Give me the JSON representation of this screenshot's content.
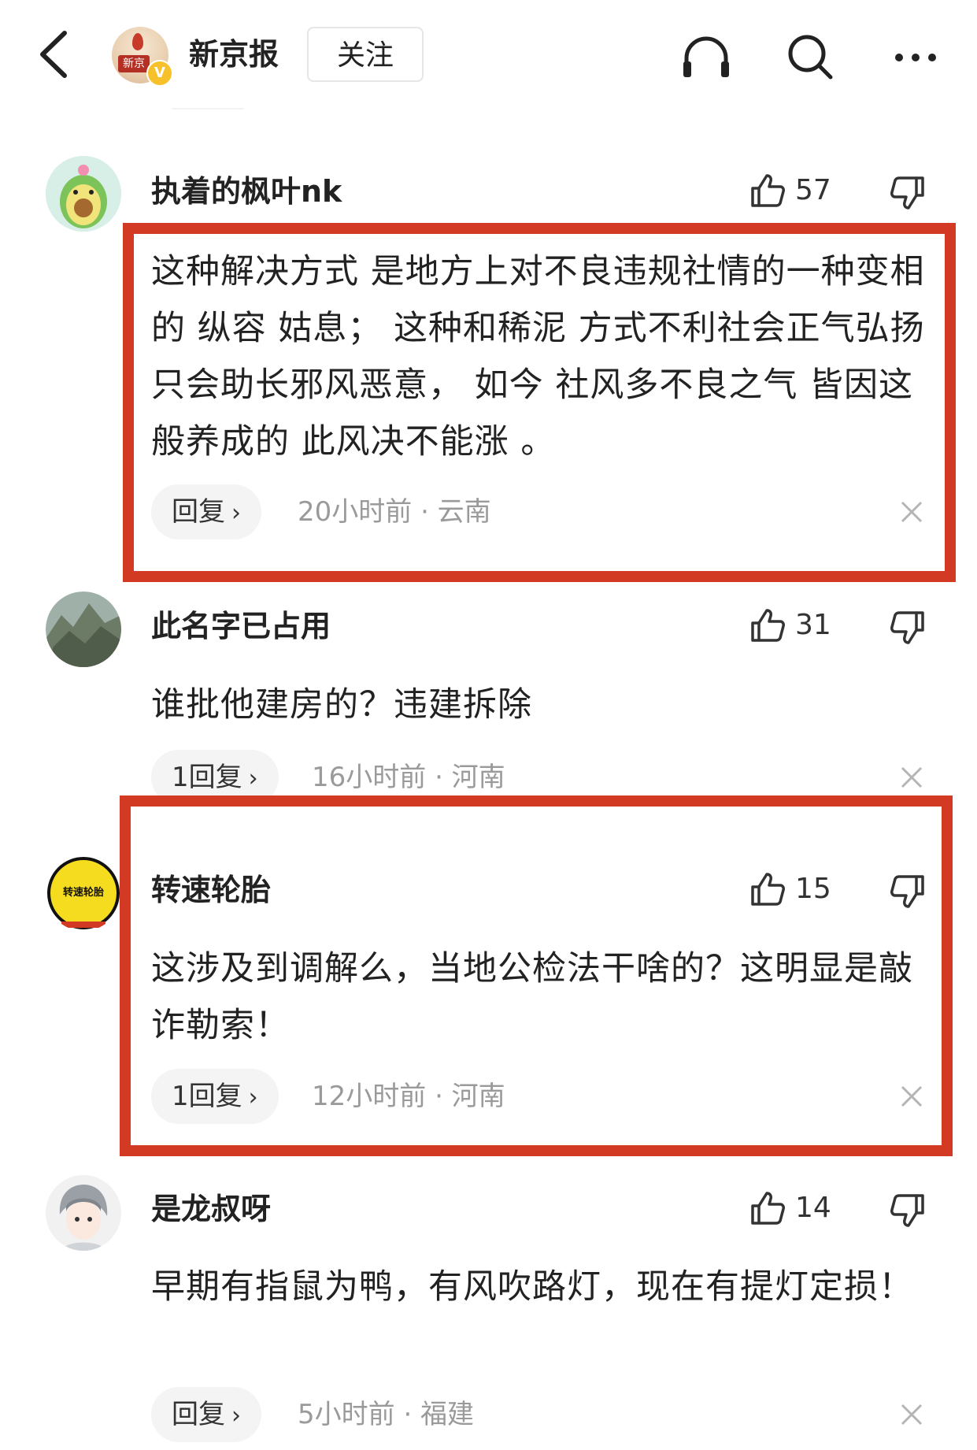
{
  "header": {
    "channel_name": "新京报",
    "avatar_text": "新京",
    "vip_badge": "V",
    "follow_label": "关注",
    "icons": [
      "back-icon",
      "headphones-icon",
      "search-icon",
      "more-icon"
    ]
  },
  "comments": [
    {
      "username": "执着的枫叶nk",
      "likes": "57",
      "text": "这种解决方式 是地方上对不良违规社情的一种变相的 纵容 姑息； 这种和稀泥 方式不利社会正气弘扬 只会助长邪风恶意， 如今 社风多不良之气 皆因这般养成的 此风决不能涨 。",
      "reply_label": "回复",
      "time_location": "20小时前 · 云南",
      "highlighted": true
    },
    {
      "username": "此名字已占用",
      "likes": "31",
      "text": "谁批他建房的？违建拆除",
      "reply_label": "1回复",
      "time_location": "16小时前 · 河南",
      "highlighted": false
    },
    {
      "username": "转速轮胎",
      "avatar_text": "转速轮胎",
      "likes": "15",
      "text": "这涉及到调解么，当地公检法干啥的？这明显是敲诈勒索！",
      "reply_label": "1回复",
      "time_location": "12小时前 · 河南",
      "highlighted": true
    },
    {
      "username": "是龙叔呀",
      "likes": "14",
      "text": "早期有指鼠为鸭，有风吹路灯，现在有提灯定损！",
      "reply_label": "回复",
      "time_location": "5小时前 · 福建",
      "highlighted": false
    }
  ],
  "colors": {
    "highlight_border": "#d23a24",
    "meta_text": "#9a9a9a",
    "reply_bg": "#f4f4f4",
    "vip_badge": "#f6c12b"
  }
}
